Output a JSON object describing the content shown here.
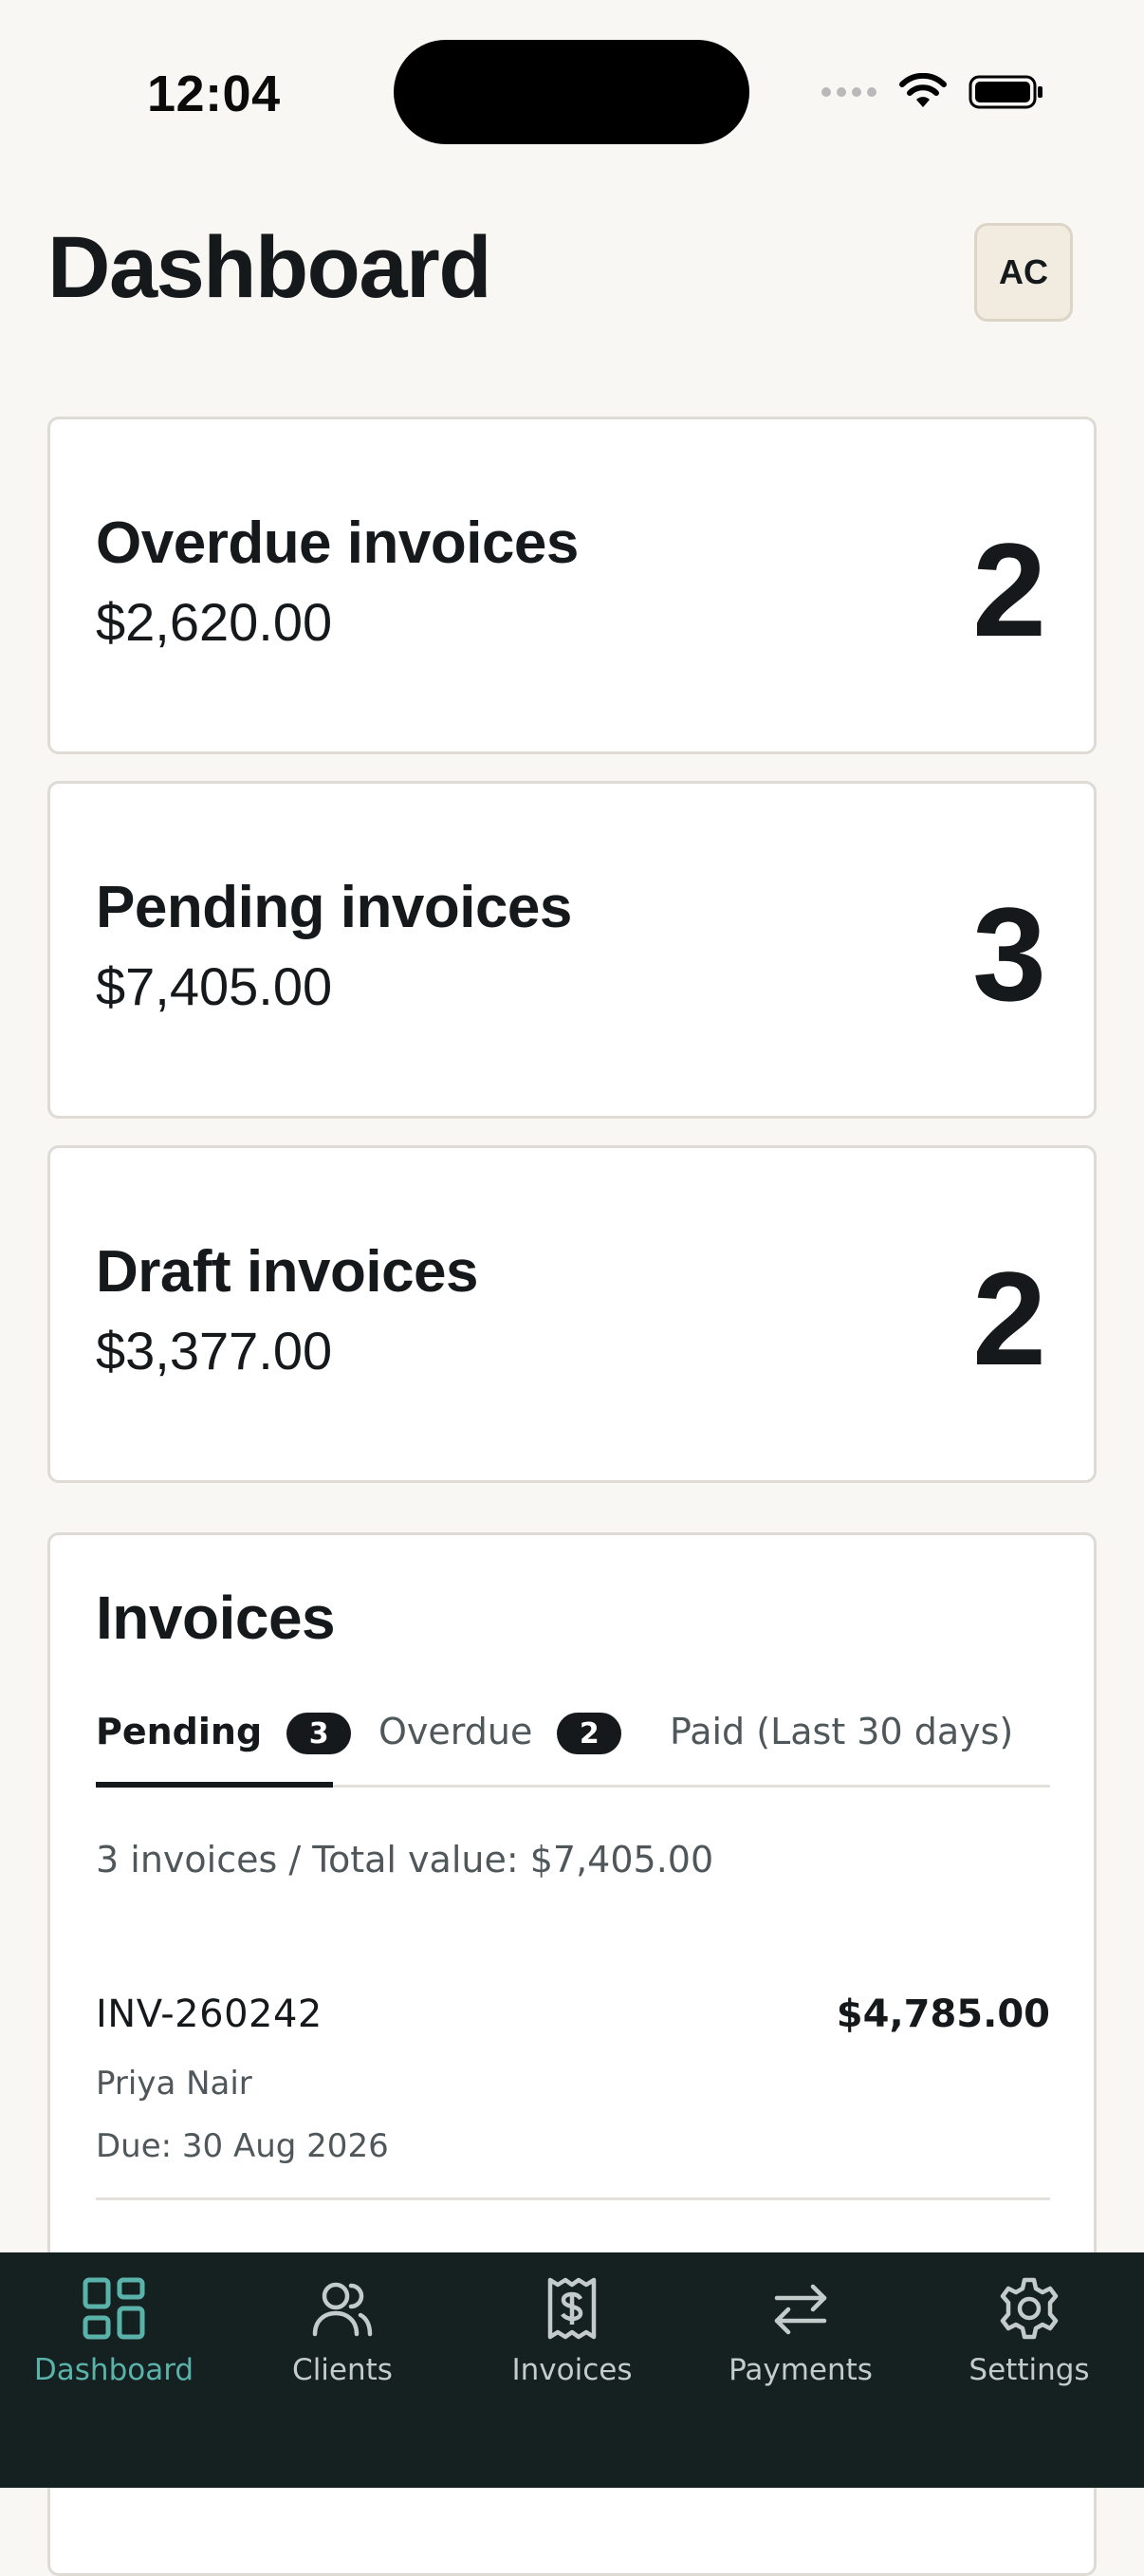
{
  "status_bar": {
    "time": "12:04"
  },
  "header": {
    "title": "Dashboard",
    "avatar_initials": "AC"
  },
  "summary_cards": [
    {
      "label": "Overdue invoices",
      "amount": "$2,620.00",
      "count": "2"
    },
    {
      "label": "Pending invoices",
      "amount": "$7,405.00",
      "count": "3"
    },
    {
      "label": "Draft invoices",
      "amount": "$3,377.00",
      "count": "2"
    }
  ],
  "invoices_panel": {
    "title": "Invoices",
    "tabs": [
      {
        "label": "Pending",
        "badge": "3",
        "active": true
      },
      {
        "label": "Overdue",
        "badge": "2",
        "active": false
      },
      {
        "label": "Paid (Last 30 days)",
        "active": false
      }
    ],
    "summary": "3 invoices / Total value: $7,405.00",
    "rows": [
      {
        "id": "INV-260242",
        "amount": "$4,785.00",
        "client": "Priya Nair",
        "due": "Due: 30 Aug 2026"
      }
    ]
  },
  "bottom_nav": {
    "items": [
      {
        "label": "Dashboard",
        "icon": "dashboard-grid-icon",
        "active": true
      },
      {
        "label": "Clients",
        "icon": "users-icon",
        "active": false
      },
      {
        "label": "Invoices",
        "icon": "receipt-dollar-icon",
        "active": false
      },
      {
        "label": "Payments",
        "icon": "arrows-swap-icon",
        "active": false
      },
      {
        "label": "Settings",
        "icon": "gear-icon",
        "active": false
      }
    ]
  },
  "colors": {
    "background": "#f8f7f4",
    "card": "#ffffff",
    "text": "#15191b",
    "nav_background": "#152020",
    "nav_active": "#5ab3aa",
    "nav_inactive": "#c4cccb"
  }
}
